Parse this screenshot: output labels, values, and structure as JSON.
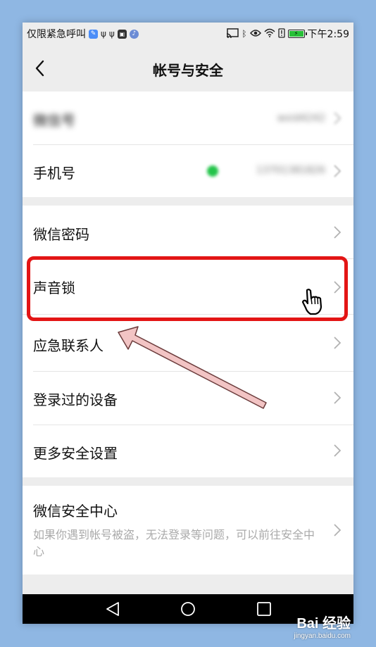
{
  "status_bar": {
    "left_text": "仅限紧急呼叫",
    "time": "下午2:59",
    "left_icons": [
      "edit-app-icon",
      "usb-icon",
      "usb-icon",
      "notification-app-icon",
      "music-app-icon"
    ],
    "right_icons": [
      "cast-icon",
      "bluetooth-icon",
      "eye-icon",
      "wifi-icon",
      "alert-icon",
      "battery-charging-icon"
    ]
  },
  "header": {
    "title": "帐号与安全",
    "back_icon": "chevron-left-icon"
  },
  "account_section": {
    "wechat_id": {
      "label": "微信号",
      "value": "wxid4242"
    },
    "phone": {
      "label": "手机号",
      "value": "13701381826"
    }
  },
  "security_section": {
    "items": [
      {
        "label": "微信密码"
      },
      {
        "label": "声音锁"
      },
      {
        "label": "应急联系人"
      },
      {
        "label": "登录过的设备"
      },
      {
        "label": "更多安全设置"
      }
    ]
  },
  "center_section": {
    "title": "微信安全中心",
    "description": "如果你遇到帐号被盗，无法登录等问题，可以前往安全中心"
  },
  "nav_bar": {
    "buttons": [
      "back-triangle-icon",
      "home-circle-icon",
      "recents-square-icon"
    ]
  },
  "watermark": {
    "logo": "Bai 经验",
    "url": "jingyan.baidu.com"
  },
  "colors": {
    "page_background": "#ededed",
    "card_background": "#ffffff",
    "highlight_red": "#e31515",
    "arrow_fill": "#f2c4c4",
    "outer_background": "#8fb7e3"
  }
}
